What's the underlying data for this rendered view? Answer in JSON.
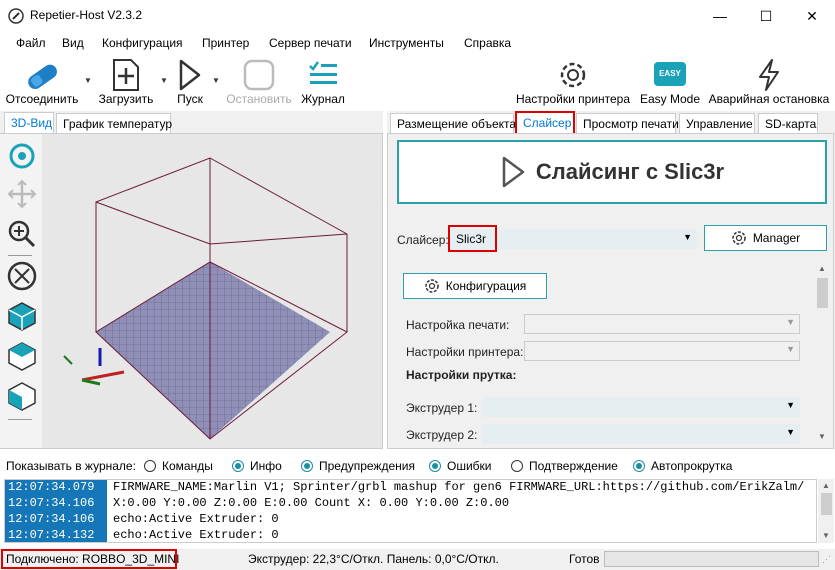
{
  "window": {
    "title": "Repetier-Host V2.3.2",
    "minimize": "—",
    "maximize": "☐",
    "close": "✕"
  },
  "menu": [
    "Файл",
    "Вид",
    "Конфигурация",
    "Принтер",
    "Сервер печати",
    "Инструменты",
    "Справка"
  ],
  "toolbar": {
    "disconnect": "Отсоединить",
    "load": "Загрузить",
    "start": "Пуск",
    "stop": "Остановить",
    "log": "Журнал",
    "printer_settings": "Настройки принтера",
    "easy_mode": "Easy Mode",
    "easy_badge": "EASY",
    "emergency": "Аварийная остановка"
  },
  "left_tabs": {
    "view3d": "3D-Вид",
    "temp_graph": "График температур"
  },
  "right_tabs": {
    "placement": "Размещение объекта",
    "slicer": "Слайсер",
    "preview": "Просмотр печати",
    "control": "Управление",
    "sdcard": "SD-карта"
  },
  "slicer": {
    "slice_button": "Слайсинг с Slic3r",
    "slicer_label": "Слайсер:",
    "slicer_value": "Slic3r",
    "manager_button": "Manager",
    "config_button": "Конфигурация",
    "print_settings_label": "Настройка печати:",
    "printer_settings_label": "Настройки принтера:",
    "filament_heading": "Настройки прутка:",
    "extruder1_label": "Экструдер 1:",
    "extruder2_label": "Экструдер 2:"
  },
  "log_filter": {
    "label": "Показывать в журнале:",
    "options": [
      {
        "label": "Команды",
        "on": false
      },
      {
        "label": "Инфо",
        "on": true
      },
      {
        "label": "Предупреждения",
        "on": true
      },
      {
        "label": "Ошибки",
        "on": true
      },
      {
        "label": "Подтверждение",
        "on": false
      },
      {
        "label": "Автопрокрутка",
        "on": true
      }
    ]
  },
  "log": [
    {
      "time": "12:07:34.079",
      "msg": "FIRMWARE_NAME:Marlin V1; Sprinter/grbl mashup for gen6 FIRMWARE_URL:https://github.com/ErikZalm/"
    },
    {
      "time": "12:07:34.106",
      "msg": "X:0.00 Y:0.00 Z:0.00 E:0.00 Count X: 0.00 Y:0.00 Z:0.00"
    },
    {
      "time": "12:07:34.106",
      "msg": "echo:Active Extruder: 0"
    },
    {
      "time": "12:07:34.132",
      "msg": "echo:Active Extruder: 0"
    }
  ],
  "status": {
    "connection": "Подключено: ROBBO_3D_MINI",
    "temps": "Экструдер: 22,3°C/Откл. Панель: 0,0°C/Откл.",
    "ready": "Готов"
  },
  "colors": {
    "accent": "#2aa0a8",
    "log_time_bg": "#1577b8",
    "highlight_box": "#dd0000",
    "bed_fill": "#8f8fb8"
  }
}
